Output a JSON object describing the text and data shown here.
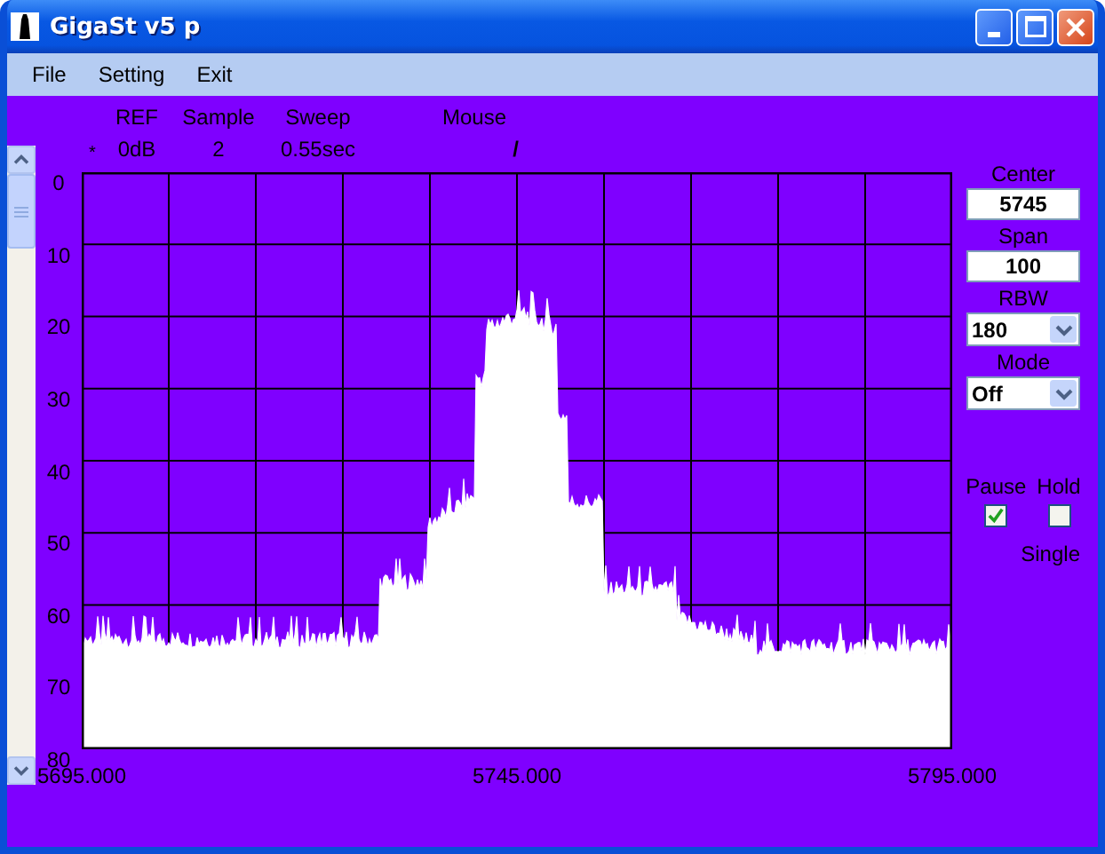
{
  "window": {
    "title": "GigaSt v5 p"
  },
  "menu": [
    "File",
    "Setting",
    "Exit"
  ],
  "readout": {
    "marker": "*",
    "columns": [
      {
        "label": "REF",
        "value": "0dB"
      },
      {
        "label": "Sample",
        "value": "2"
      },
      {
        "label": "Sweep",
        "value": "0.55sec"
      },
      {
        "label": "Mouse",
        "value": "/"
      }
    ]
  },
  "y_axis_labels": [
    "0",
    "10",
    "20",
    "30",
    "40",
    "50",
    "60",
    "70",
    "80"
  ],
  "x_axis_labels": [
    "5695.000",
    "5745.000",
    "5795.000"
  ],
  "controls": [
    {
      "kind": "field",
      "label": "Center",
      "value": "5745"
    },
    {
      "kind": "field",
      "label": "Span",
      "value": "100"
    },
    {
      "kind": "dropdown",
      "label": "RBW",
      "value": "180"
    },
    {
      "kind": "dropdown",
      "label": "Mode",
      "value": "Off"
    }
  ],
  "checkboxes": [
    {
      "label": "Pause",
      "checked": true
    },
    {
      "label": "Hold",
      "checked": false
    }
  ],
  "single_label": "Single"
}
